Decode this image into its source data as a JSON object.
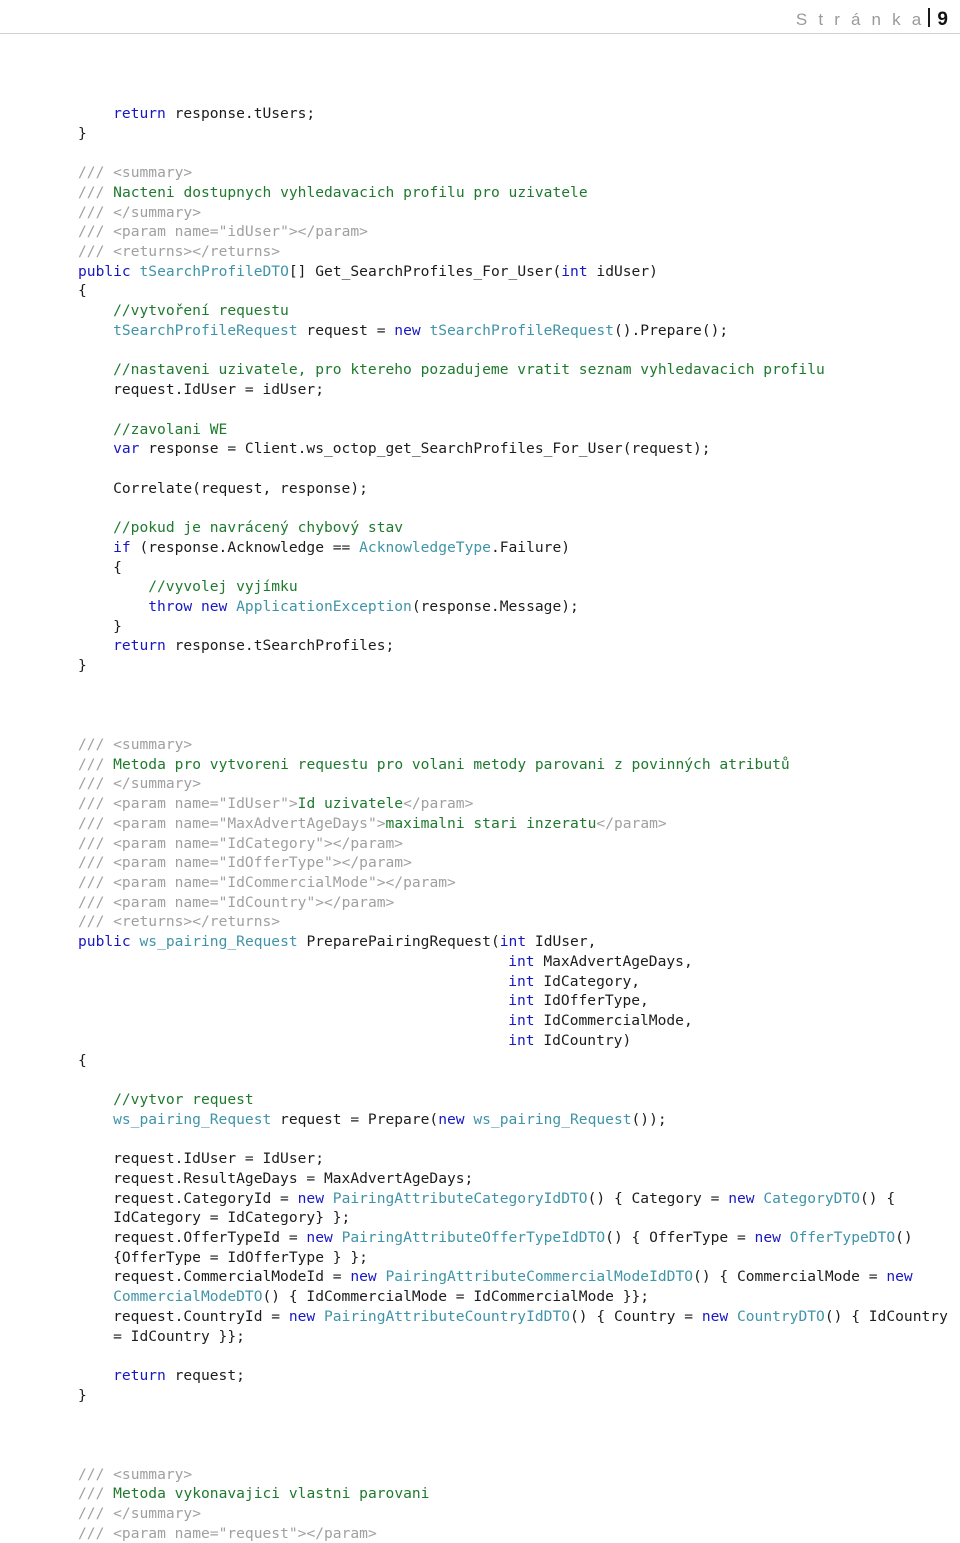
{
  "header": {
    "label": "S t r á n k a",
    "separator": "|",
    "page_number": "9"
  },
  "colors": {
    "keyword": "#1717c4",
    "type": "#3f94a8",
    "comment": "#1f7a2e",
    "xmldoc": "#a0a0a0",
    "plain": "#1c1c1c",
    "rule": "#d2d2d2",
    "header_text": "#9a9a9a",
    "page_number": "#111111",
    "background": "#ffffff"
  },
  "code_lines": [
    {
      "indent": 4,
      "tokens": [
        {
          "t": "return",
          "c": "kw"
        },
        {
          "t": " response.tUsers;",
          "c": "pl"
        }
      ]
    },
    {
      "indent": 0,
      "tokens": [
        {
          "t": "}",
          "c": "pl"
        }
      ]
    },
    {
      "indent": 0,
      "tokens": []
    },
    {
      "indent": 0,
      "tokens": [
        {
          "t": "/// <summary>",
          "c": "xd"
        }
      ]
    },
    {
      "indent": 0,
      "tokens": [
        {
          "t": "/// ",
          "c": "xd"
        },
        {
          "t": "Nacteni dostupnych vyhledavacich profilu pro uzivatele",
          "c": "cm"
        }
      ]
    },
    {
      "indent": 0,
      "tokens": [
        {
          "t": "/// </summary>",
          "c": "xd"
        }
      ]
    },
    {
      "indent": 0,
      "tokens": [
        {
          "t": "/// <param name=\"idUser\"></param>",
          "c": "xd"
        }
      ]
    },
    {
      "indent": 0,
      "tokens": [
        {
          "t": "/// <returns></returns>",
          "c": "xd"
        }
      ]
    },
    {
      "indent": 0,
      "tokens": [
        {
          "t": "public",
          "c": "kw"
        },
        {
          "t": " ",
          "c": "pl"
        },
        {
          "t": "tSearchProfileDTO",
          "c": "typ"
        },
        {
          "t": "[] Get_SearchProfiles_For_User(",
          "c": "pl"
        },
        {
          "t": "int",
          "c": "kw"
        },
        {
          "t": " idUser)",
          "c": "pl"
        }
      ]
    },
    {
      "indent": 0,
      "tokens": [
        {
          "t": "{",
          "c": "pl"
        }
      ]
    },
    {
      "indent": 4,
      "tokens": [
        {
          "t": "//vytvoření requestu",
          "c": "cm"
        }
      ]
    },
    {
      "indent": 4,
      "tokens": [
        {
          "t": "tSearchProfileRequest",
          "c": "typ"
        },
        {
          "t": " request = ",
          "c": "pl"
        },
        {
          "t": "new",
          "c": "kw"
        },
        {
          "t": " ",
          "c": "pl"
        },
        {
          "t": "tSearchProfileRequest",
          "c": "typ"
        },
        {
          "t": "().Prepare();",
          "c": "pl"
        }
      ]
    },
    {
      "indent": 0,
      "tokens": []
    },
    {
      "indent": 4,
      "tokens": [
        {
          "t": "//nastaveni uzivatele, pro ktereho pozadujeme vratit seznam vyhledavacich profilu",
          "c": "cm"
        }
      ]
    },
    {
      "indent": 4,
      "tokens": [
        {
          "t": "request.IdUser = idUser;",
          "c": "pl"
        }
      ]
    },
    {
      "indent": 0,
      "tokens": []
    },
    {
      "indent": 4,
      "tokens": [
        {
          "t": "//zavolani WE",
          "c": "cm"
        }
      ]
    },
    {
      "indent": 4,
      "tokens": [
        {
          "t": "var",
          "c": "kw"
        },
        {
          "t": " response = Client.ws_octop_get_SearchProfiles_For_User(request);",
          "c": "pl"
        }
      ]
    },
    {
      "indent": 0,
      "tokens": []
    },
    {
      "indent": 4,
      "tokens": [
        {
          "t": "Correlate(request, response);",
          "c": "pl"
        }
      ]
    },
    {
      "indent": 0,
      "tokens": []
    },
    {
      "indent": 4,
      "tokens": [
        {
          "t": "//pokud je navrácený chybový stav",
          "c": "cm"
        }
      ]
    },
    {
      "indent": 4,
      "tokens": [
        {
          "t": "if",
          "c": "kw"
        },
        {
          "t": " (response.Acknowledge == ",
          "c": "pl"
        },
        {
          "t": "AcknowledgeType",
          "c": "typ"
        },
        {
          "t": ".Failure)",
          "c": "pl"
        }
      ]
    },
    {
      "indent": 4,
      "tokens": [
        {
          "t": "{",
          "c": "pl"
        }
      ]
    },
    {
      "indent": 8,
      "tokens": [
        {
          "t": "//vyvolej vyjímku",
          "c": "cm"
        }
      ]
    },
    {
      "indent": 8,
      "tokens": [
        {
          "t": "throw",
          "c": "kw"
        },
        {
          "t": " ",
          "c": "pl"
        },
        {
          "t": "new",
          "c": "kw"
        },
        {
          "t": " ",
          "c": "pl"
        },
        {
          "t": "ApplicationException",
          "c": "typ"
        },
        {
          "t": "(response.Message);",
          "c": "pl"
        }
      ]
    },
    {
      "indent": 4,
      "tokens": [
        {
          "t": "}",
          "c": "pl"
        }
      ]
    },
    {
      "indent": 4,
      "tokens": [
        {
          "t": "return",
          "c": "kw"
        },
        {
          "t": " response.tSearchProfiles;",
          "c": "pl"
        }
      ]
    },
    {
      "indent": 0,
      "tokens": [
        {
          "t": "}",
          "c": "pl"
        }
      ]
    },
    {
      "indent": 0,
      "tokens": []
    },
    {
      "indent": 0,
      "tokens": []
    },
    {
      "indent": 0,
      "tokens": []
    },
    {
      "indent": 0,
      "tokens": [
        {
          "t": "/// <summary>",
          "c": "xd"
        }
      ]
    },
    {
      "indent": 0,
      "tokens": [
        {
          "t": "/// ",
          "c": "xd"
        },
        {
          "t": "Metoda pro vytvoreni requestu pro volani metody parovani z povinných atributů",
          "c": "cm"
        }
      ]
    },
    {
      "indent": 0,
      "tokens": [
        {
          "t": "/// </summary>",
          "c": "xd"
        }
      ]
    },
    {
      "indent": 0,
      "tokens": [
        {
          "t": "/// <param name=\"IdUser\">",
          "c": "xd"
        },
        {
          "t": "Id uzivatele",
          "c": "cm"
        },
        {
          "t": "</param>",
          "c": "xd"
        }
      ]
    },
    {
      "indent": 0,
      "tokens": [
        {
          "t": "/// <param name=\"MaxAdvertAgeDays\">",
          "c": "xd"
        },
        {
          "t": "maximalni stari inzeratu",
          "c": "cm"
        },
        {
          "t": "</param>",
          "c": "xd"
        }
      ]
    },
    {
      "indent": 0,
      "tokens": [
        {
          "t": "/// <param name=\"IdCategory\"></param>",
          "c": "xd"
        }
      ]
    },
    {
      "indent": 0,
      "tokens": [
        {
          "t": "/// <param name=\"IdOfferType\"></param>",
          "c": "xd"
        }
      ]
    },
    {
      "indent": 0,
      "tokens": [
        {
          "t": "/// <param name=\"IdCommercialMode\"></param>",
          "c": "xd"
        }
      ]
    },
    {
      "indent": 0,
      "tokens": [
        {
          "t": "/// <param name=\"IdCountry\"></param>",
          "c": "xd"
        }
      ]
    },
    {
      "indent": 0,
      "tokens": [
        {
          "t": "/// <returns></returns>",
          "c": "xd"
        }
      ]
    },
    {
      "indent": 0,
      "tokens": [
        {
          "t": "public",
          "c": "kw"
        },
        {
          "t": " ",
          "c": "pl"
        },
        {
          "t": "ws_pairing_Request",
          "c": "typ"
        },
        {
          "t": " PreparePairingRequest(",
          "c": "pl"
        },
        {
          "t": "int",
          "c": "kw"
        },
        {
          "t": " IdUser,",
          "c": "pl"
        }
      ]
    },
    {
      "indent": 49,
      "tokens": [
        {
          "t": "int",
          "c": "kw"
        },
        {
          "t": " MaxAdvertAgeDays,",
          "c": "pl"
        }
      ]
    },
    {
      "indent": 49,
      "tokens": [
        {
          "t": "int",
          "c": "kw"
        },
        {
          "t": " IdCategory,",
          "c": "pl"
        }
      ]
    },
    {
      "indent": 49,
      "tokens": [
        {
          "t": "int",
          "c": "kw"
        },
        {
          "t": " IdOfferType,",
          "c": "pl"
        }
      ]
    },
    {
      "indent": 49,
      "tokens": [
        {
          "t": "int",
          "c": "kw"
        },
        {
          "t": " IdCommercialMode,",
          "c": "pl"
        }
      ]
    },
    {
      "indent": 49,
      "tokens": [
        {
          "t": "int",
          "c": "kw"
        },
        {
          "t": " IdCountry)",
          "c": "pl"
        }
      ]
    },
    {
      "indent": 0,
      "tokens": [
        {
          "t": "{",
          "c": "pl"
        }
      ]
    },
    {
      "indent": 0,
      "tokens": []
    },
    {
      "indent": 4,
      "tokens": [
        {
          "t": "//vytvor request",
          "c": "cm"
        }
      ]
    },
    {
      "indent": 4,
      "tokens": [
        {
          "t": "ws_pairing_Request",
          "c": "typ"
        },
        {
          "t": " request = Prepare(",
          "c": "pl"
        },
        {
          "t": "new",
          "c": "kw"
        },
        {
          "t": " ",
          "c": "pl"
        },
        {
          "t": "ws_pairing_Request",
          "c": "typ"
        },
        {
          "t": "());",
          "c": "pl"
        }
      ]
    },
    {
      "indent": 0,
      "tokens": []
    },
    {
      "indent": 4,
      "tokens": [
        {
          "t": "request.IdUser = IdUser;",
          "c": "pl"
        }
      ]
    },
    {
      "indent": 4,
      "tokens": [
        {
          "t": "request.ResultAgeDays = MaxAdvertAgeDays;",
          "c": "pl"
        }
      ]
    },
    {
      "indent": 4,
      "tokens": [
        {
          "t": "request.CategoryId = ",
          "c": "pl"
        },
        {
          "t": "new",
          "c": "kw"
        },
        {
          "t": " ",
          "c": "pl"
        },
        {
          "t": "PairingAttributeCategoryIdDTO",
          "c": "typ"
        },
        {
          "t": "() { Category = ",
          "c": "pl"
        },
        {
          "t": "new",
          "c": "kw"
        },
        {
          "t": " ",
          "c": "pl"
        },
        {
          "t": "CategoryDTO",
          "c": "typ"
        },
        {
          "t": "() { IdCategory = IdCategory} };",
          "c": "pl"
        }
      ]
    },
    {
      "indent": 4,
      "tokens": [
        {
          "t": "request.OfferTypeId = ",
          "c": "pl"
        },
        {
          "t": "new",
          "c": "kw"
        },
        {
          "t": " ",
          "c": "pl"
        },
        {
          "t": "PairingAttributeOfferTypeIdDTO",
          "c": "typ"
        },
        {
          "t": "() { OfferType = ",
          "c": "pl"
        },
        {
          "t": "new",
          "c": "kw"
        },
        {
          "t": " ",
          "c": "pl"
        },
        {
          "t": "OfferTypeDTO",
          "c": "typ"
        },
        {
          "t": "() {OfferType = IdOfferType } };",
          "c": "pl"
        }
      ]
    },
    {
      "indent": 4,
      "tokens": [
        {
          "t": "request.CommercialModeId = ",
          "c": "pl"
        },
        {
          "t": "new",
          "c": "kw"
        },
        {
          "t": " ",
          "c": "pl"
        },
        {
          "t": "PairingAttributeCommercialModeIdDTO",
          "c": "typ"
        },
        {
          "t": "() { CommercialMode = ",
          "c": "pl"
        },
        {
          "t": "new",
          "c": "kw"
        },
        {
          "t": " ",
          "c": "pl"
        },
        {
          "t": "CommercialModeDTO",
          "c": "typ"
        },
        {
          "t": "() { IdCommercialMode = IdCommercialMode }};",
          "c": "pl"
        }
      ]
    },
    {
      "indent": 4,
      "tokens": [
        {
          "t": "request.CountryId = ",
          "c": "pl"
        },
        {
          "t": "new",
          "c": "kw"
        },
        {
          "t": " ",
          "c": "pl"
        },
        {
          "t": "PairingAttributeCountryIdDTO",
          "c": "typ"
        },
        {
          "t": "() { Country = ",
          "c": "pl"
        },
        {
          "t": "new",
          "c": "kw"
        },
        {
          "t": " ",
          "c": "pl"
        },
        {
          "t": "CountryDTO",
          "c": "typ"
        },
        {
          "t": "() { IdCountry = IdCountry }};",
          "c": "pl"
        }
      ]
    },
    {
      "indent": 0,
      "tokens": []
    },
    {
      "indent": 4,
      "tokens": [
        {
          "t": "return",
          "c": "kw"
        },
        {
          "t": " request;",
          "c": "pl"
        }
      ]
    },
    {
      "indent": 0,
      "tokens": [
        {
          "t": "}",
          "c": "pl"
        }
      ]
    },
    {
      "indent": 0,
      "tokens": []
    },
    {
      "indent": 0,
      "tokens": []
    },
    {
      "indent": 0,
      "tokens": []
    },
    {
      "indent": 0,
      "tokens": [
        {
          "t": "/// <summary>",
          "c": "xd"
        }
      ]
    },
    {
      "indent": 0,
      "tokens": [
        {
          "t": "/// ",
          "c": "xd"
        },
        {
          "t": "Metoda vykonavajici vlastni parovani",
          "c": "cm"
        }
      ]
    },
    {
      "indent": 0,
      "tokens": [
        {
          "t": "/// </summary>",
          "c": "xd"
        }
      ]
    },
    {
      "indent": 0,
      "tokens": [
        {
          "t": "/// <param name=\"request\"></param>",
          "c": "xd"
        }
      ]
    }
  ]
}
